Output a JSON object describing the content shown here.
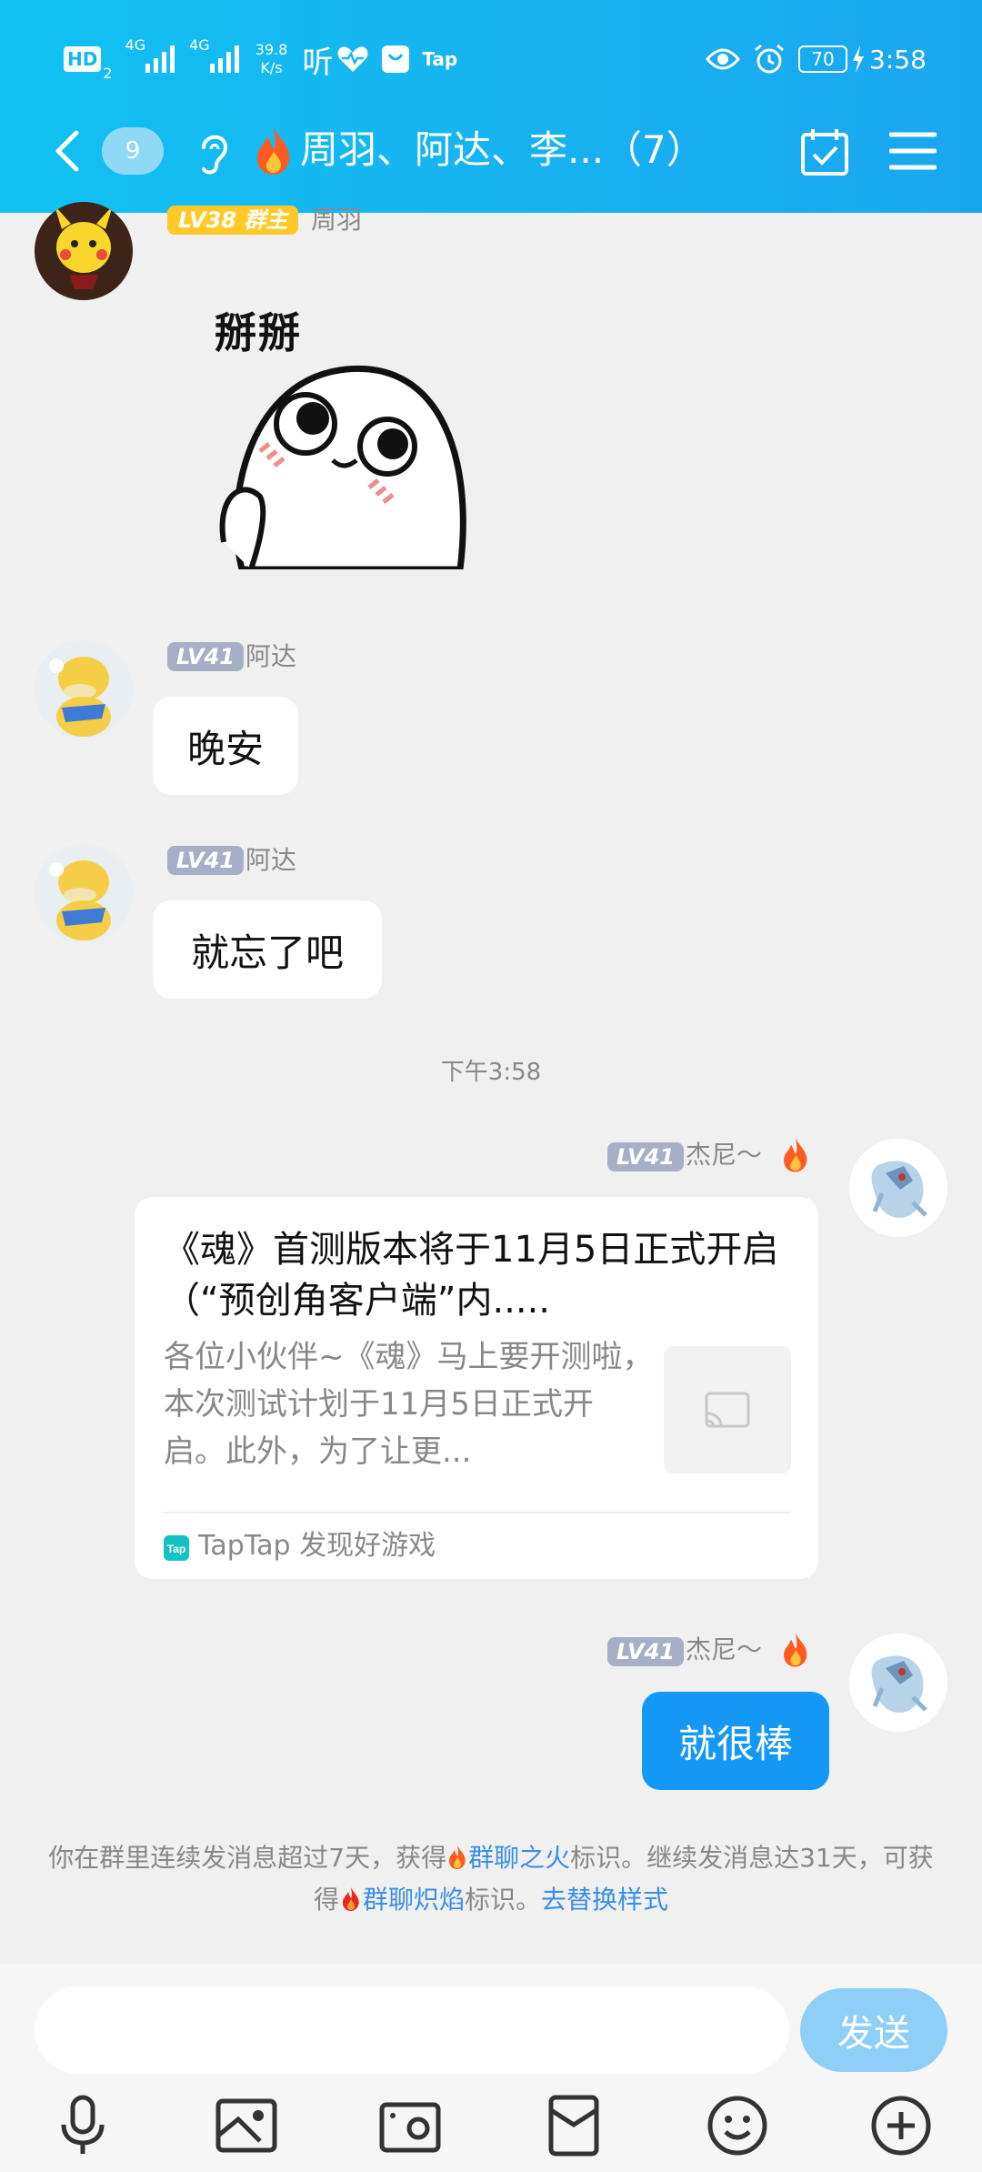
{
  "status_bar": {
    "hd": "HD",
    "hd_sub": "2",
    "net1": "4G",
    "net2": "4G",
    "speed_value": "39.8",
    "speed_unit": "K/s",
    "app1": "听",
    "tap": "Tap",
    "battery": "70",
    "time": "3:58"
  },
  "header": {
    "unread_count": "9",
    "title": "周羽、阿达、李...（7）"
  },
  "messages": [
    {
      "level": "LV38 群主",
      "nickname": "周羽"
    },
    {
      "sticker_text": "掰掰"
    },
    {
      "level": "LV41",
      "nickname": "阿达",
      "text": "晚安"
    },
    {
      "level": "LV41",
      "nickname": "阿达",
      "text": "就忘了吧"
    },
    {
      "timestamp": "下午3:58"
    },
    {
      "level": "LV41",
      "nickname": "杰尼～",
      "card": {
        "title": "《魂》首测版本将于11月5日正式开启（“预创角客户端”内.....",
        "description": "各位小伙伴~《魂》马上要开测啦，本次测试计划于11月5日正式开启。此外，为了让更...",
        "source": "TapTap 发现好游戏"
      }
    },
    {
      "level": "LV41",
      "nickname": "杰尼～",
      "text": "就很棒"
    }
  ],
  "notice": {
    "part1": "你在群里连续发消息超过7天，获得",
    "link1": "群聊之火",
    "part2": "标识。继续发消息达31天，可获得",
    "link2": "群聊炽焰",
    "part3": "标识。",
    "link3": "去替换样式"
  },
  "input_bar": {
    "placeholder": "",
    "send_label": "发送"
  },
  "colors": {
    "header_gradient_start": "#12c1f2",
    "header_gradient_end": "#1aa6ef",
    "send_bubble": "#1597f5",
    "level_badge": "#a7afc6",
    "owner_badge": "#ffc928",
    "link": "#3a8ee6"
  }
}
